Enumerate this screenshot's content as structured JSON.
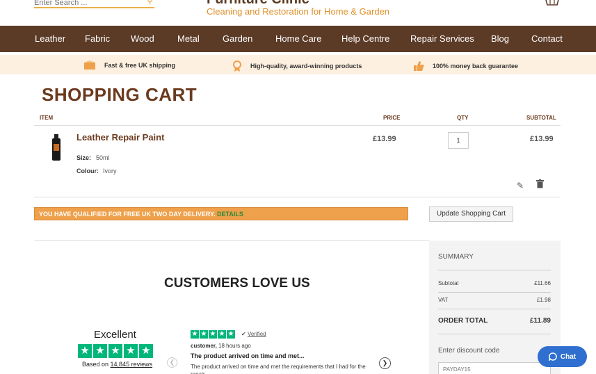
{
  "header": {
    "search_placeholder": "Enter Search ...",
    "logo_top": "Furniture Clinic",
    "logo_tagline": "Cleaning and Restoration for Home & Garden"
  },
  "nav": {
    "items": [
      "Leather",
      "Fabric",
      "Wood",
      "Metal",
      "Garden",
      "Home Care",
      "Help Centre",
      "Repair Services",
      "Blog",
      "Contact"
    ]
  },
  "benefits": [
    {
      "text": "Fast & free UK shipping",
      "icon": "delivery-box-icon"
    },
    {
      "text": "High-quality, award-winning products",
      "icon": "award-icon"
    },
    {
      "text": "100% money back guarantee",
      "icon": "thumbs-up-icon"
    }
  ],
  "cart": {
    "title": "SHOPPING CART",
    "headers": {
      "item": "ITEM",
      "price": "PRICE",
      "qty": "QTY",
      "subtotal": "SUBTOTAL"
    },
    "item": {
      "name": "Leather Repair Paint",
      "size_label": "Size:",
      "size_value": "50ml",
      "colour_label": "Colour:",
      "colour_value": "Ivory",
      "price": "£13.99",
      "qty": "1",
      "subtotal": "£13.99"
    },
    "delivery_msg": "YOU HAVE QUALIFIED FOR FREE UK TWO DAY DELIVERY.",
    "delivery_link": "DETAILS",
    "update_button": "Update Shopping Cart"
  },
  "reviews": {
    "section_title": "CUSTOMERS LOVE US",
    "rating_word": "Excellent",
    "based_on_prefix": "Based on",
    "review_count": "14,845 reviews",
    "verified": "Verified",
    "reviewer": "customer,",
    "reviewer_time": "18 hours ago",
    "review_title": "The product arrived on time and met...",
    "review_body": "The product arrived on time and met the requirements that I had for the repair.",
    "stars": 5
  },
  "summary": {
    "title": "SUMMARY",
    "subtotal_label": "Subtotal",
    "subtotal_value": "£11.66",
    "vat_label": "VAT",
    "vat_value": "£1.98",
    "total_label": "ORDER TOTAL",
    "total_value": "£11.89",
    "discount_label": "Enter discount code",
    "discount_placeholder": "PAYDAY15"
  },
  "chat": {
    "label": "Chat"
  },
  "colors": {
    "brand_brown": "#5b3a26",
    "accent_orange": "#eea04a",
    "trustpilot_green": "#00b67a",
    "chat_blue": "#2f6fcf"
  }
}
